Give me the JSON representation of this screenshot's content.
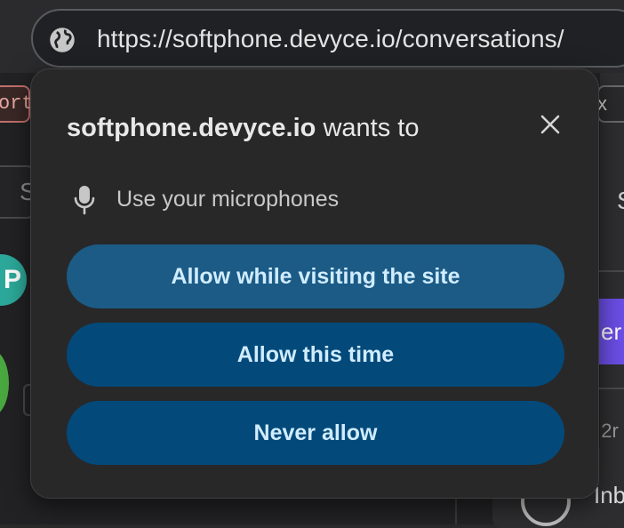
{
  "browser": {
    "url": "https://softphone.devyce.io/conversations/"
  },
  "background": {
    "left_tag_text": "ort",
    "left_search_text": "S",
    "left_avatar_text": "P",
    "right_tab_text": "x",
    "right_heading_fragment": "S",
    "right_button_fragment": "er",
    "right_meta_fragment": ", 2r",
    "bottom_item_fragment": "Inb"
  },
  "dialog": {
    "site": "softphone.devyce.io",
    "title_suffix": "wants to",
    "permission_icon": "microphone-icon",
    "permission_text": "Use your microphones",
    "close_icon": "close-icon",
    "buttons": {
      "allow_visit": "Allow while visiting the site",
      "allow_once": "Allow this time",
      "never": "Never allow"
    }
  },
  "colors": {
    "dialog_bg": "#282829",
    "primary_button": "#1b5b86",
    "secondary_button": "#034a7a",
    "button_text": "#d0ecff",
    "accent_purple": "#6b4ee6"
  }
}
